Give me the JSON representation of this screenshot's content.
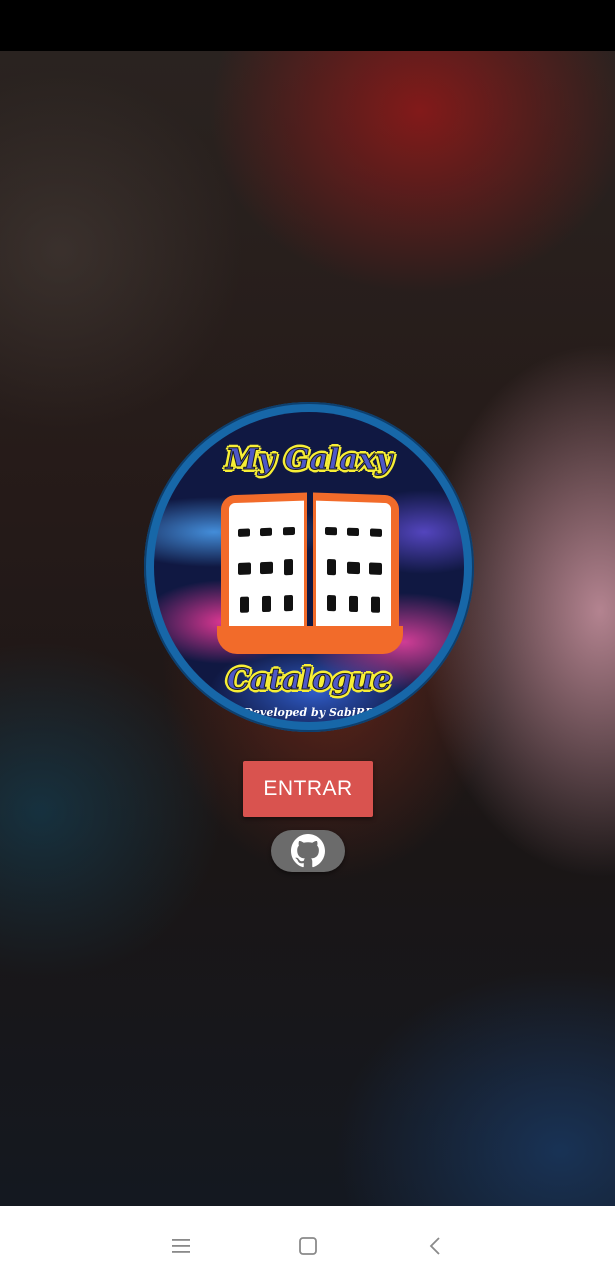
{
  "logo": {
    "title_top": "My Galaxy",
    "title_bottom": "Catalogue",
    "credit": "Developed by SabiRD",
    "colors": {
      "ring": "#1767a8",
      "book": "#f26b2a",
      "title_outline": "#f7ee36",
      "title_fill": "#4e58c8"
    }
  },
  "actions": {
    "enter_label": "ENTRAR",
    "enter_color": "#d9534f",
    "github_icon": "github-icon"
  },
  "navigation": {
    "icons": [
      "menu-icon",
      "home-square-icon",
      "back-chevron-icon"
    ]
  }
}
